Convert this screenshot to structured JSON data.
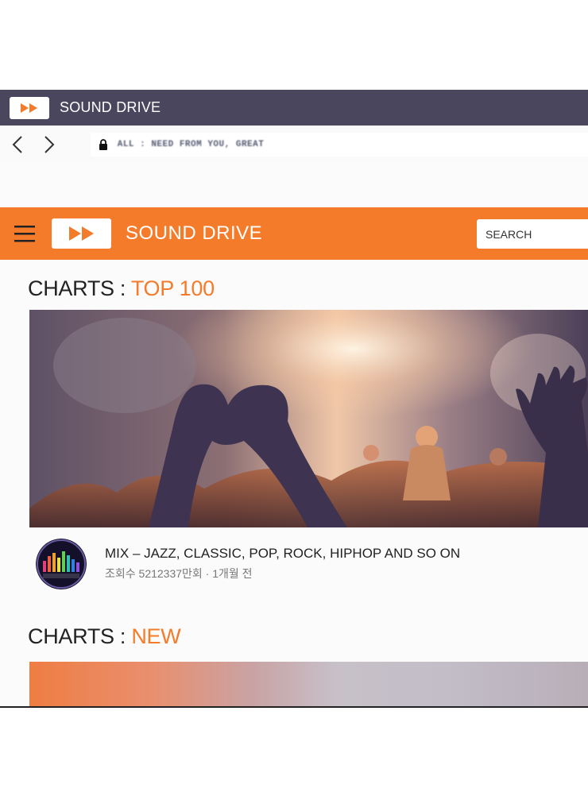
{
  "browser": {
    "tab_title": "SOUND DRIVE",
    "address": "ALL : NEED FROM YOU, GREAT"
  },
  "site": {
    "name": "SOUND DRIVE",
    "search_placeholder": "SEARCH",
    "accent_color": "#f47b2a",
    "titlebar_color": "#49465e"
  },
  "sections": {
    "top100": {
      "prefix": "CHARTS : ",
      "highlight": "TOP 100"
    },
    "new": {
      "prefix": "CHARTS : ",
      "highlight": "NEW"
    }
  },
  "video": {
    "title": "MIX – JAZZ, CLASSIC, POP, ROCK, HIPHOP AND SO ON",
    "stats": "조회수 5212337만회 · 1개월 전"
  },
  "icons": {
    "logo": "fast-forward-icon",
    "menu": "hamburger-icon",
    "back": "chevron-left-icon",
    "forward": "chevron-right-icon",
    "lock": "lock-icon"
  }
}
